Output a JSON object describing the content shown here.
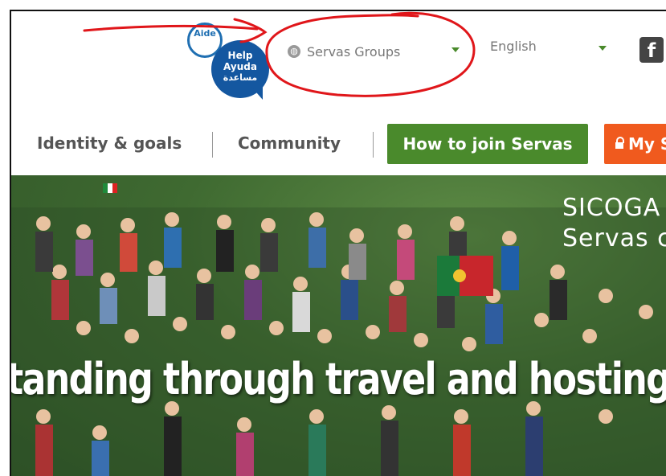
{
  "header": {
    "help_badge": {
      "top_text": "Aide",
      "lines": [
        "Help",
        "Ayuda",
        "مساعدة"
      ]
    },
    "groups_select": {
      "icon": "globe-icon",
      "value": "Servas Groups"
    },
    "language_select": {
      "value": "English"
    },
    "social": {
      "icon": "facebook-icon",
      "glyph": "f"
    }
  },
  "nav": {
    "items": [
      {
        "label": "Identity & goals"
      },
      {
        "label": "Community"
      }
    ],
    "join_button": "How to join Servas",
    "my_button": "My S",
    "colors": {
      "join": "#4a8a2c",
      "my": "#f05a1e"
    }
  },
  "hero": {
    "title_line1": "SICOGA",
    "title_line2": "Servas c",
    "tagline": "tanding through travel and hosting"
  },
  "annotation": {
    "color": "#e0161a",
    "note": ""
  }
}
